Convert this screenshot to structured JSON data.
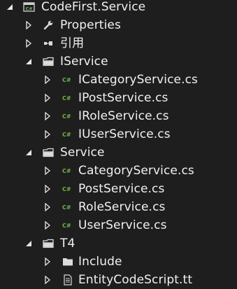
{
  "tree": {
    "root": {
      "label": "CodeFirst.Service",
      "icon": "csharp-project-icon"
    },
    "properties": {
      "label": "Properties",
      "icon": "wrench-icon"
    },
    "references": {
      "label": "引用",
      "icon": "references-icon"
    },
    "iservice_folder": {
      "label": "IService",
      "icon": "folder-icon",
      "files": [
        {
          "label": "ICategoryService.cs",
          "icon": "csharp-file-icon"
        },
        {
          "label": "IPostService.cs",
          "icon": "csharp-file-icon"
        },
        {
          "label": "IRoleService.cs",
          "icon": "csharp-file-icon"
        },
        {
          "label": "IUserService.cs",
          "icon": "csharp-file-icon"
        }
      ]
    },
    "service_folder": {
      "label": "Service",
      "icon": "folder-icon",
      "files": [
        {
          "label": "CategoryService.cs",
          "icon": "csharp-file-icon"
        },
        {
          "label": "PostService.cs",
          "icon": "csharp-file-icon"
        },
        {
          "label": "RoleService.cs",
          "icon": "csharp-file-icon"
        },
        {
          "label": "UserService.cs",
          "icon": "csharp-file-icon"
        }
      ]
    },
    "t4_folder": {
      "label": "T4",
      "icon": "folder-icon",
      "children": [
        {
          "label": "Include",
          "icon": "folder-icon"
        },
        {
          "label": "EntityCodeScript.tt",
          "icon": "text-template-icon"
        }
      ]
    }
  },
  "colors": {
    "background": "#1e1e1e",
    "text": "#f1f1f1",
    "csharp_green": "#6fb54d",
    "folder": "#dcdcdc"
  }
}
